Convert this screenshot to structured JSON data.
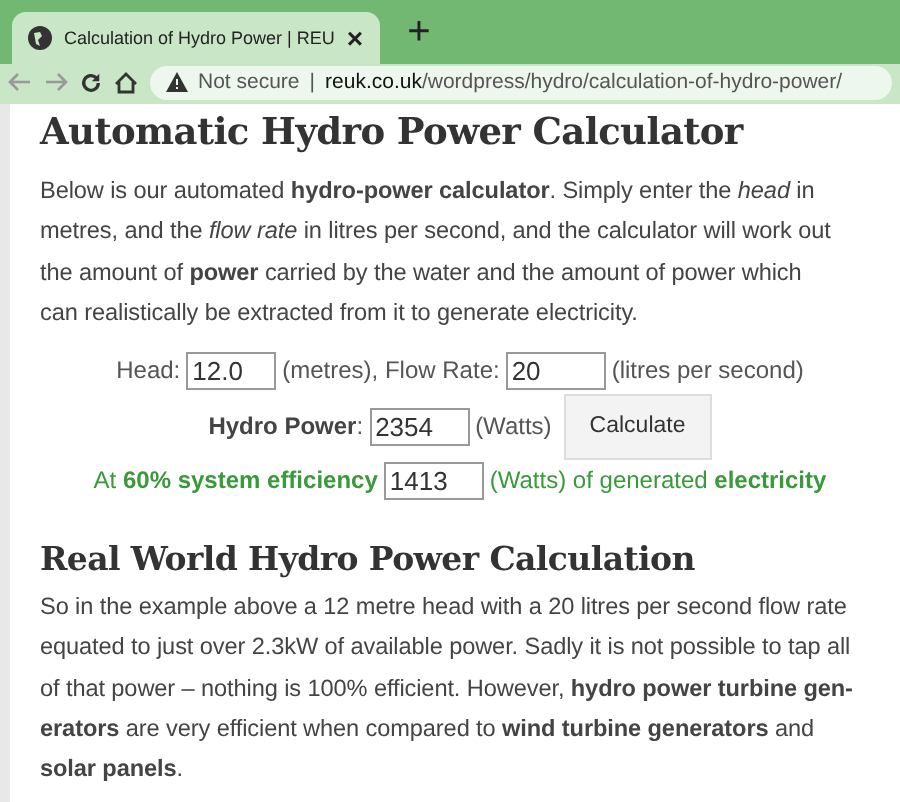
{
  "browser": {
    "tab": {
      "title": "Calculation of Hydro Power | REU",
      "close": "×"
    },
    "new_tab": "+",
    "security": "Not secure",
    "separator": "|",
    "url_host": "reuk.co.uk",
    "url_path": "/wordpress/hydro/calculation-of-hydro-power/"
  },
  "heading": "Automatic Hydro Power Calculator",
  "intro_lines": [
    "Below is our automated **hydro-power calculator**. Simply enter the *head* in",
    "metres, and the *flow rate* in litres per second, and the calculator will work out",
    "the amount of **power** carried by the water and the amount of power which",
    "can realistically be extracted from it to generate electricity."
  ],
  "calculator": {
    "head_label": "Head:",
    "head_value": "12.0",
    "head_unit": "(metres), Flow Rate:",
    "flow_value": "20",
    "flow_unit": "(litres per second)",
    "power_label": "Hydro Power",
    "power_colon": ":",
    "power_value": "2354",
    "power_unit": "(Watts)",
    "button": "Calculate",
    "efficiency_lead": "At **60% system efficiency**",
    "efficiency_value": "1413",
    "efficiency_tail": "(Watts) of generated **electricity**"
  },
  "heading_2": "Real World Hydro Power Calculation",
  "body_lines": [
    "So in the example above a 12 metre head with a 20 litres per second flow rate",
    "equated to just over 2.3kW of available power. Sadly it is not possible to tap all",
    "of that power – nothing is 100% efficient. However, **hydro power turbine gen-**",
    "**erators** are very efficient when compared to **wind turbine generators** and",
    "**solar panels**."
  ]
}
